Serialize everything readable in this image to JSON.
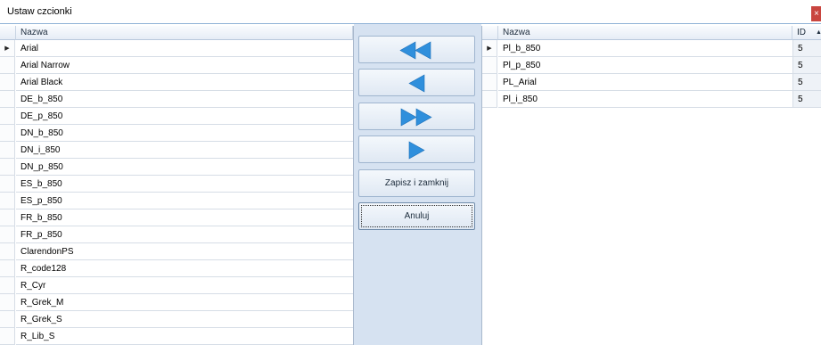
{
  "window": {
    "title": "Ustaw czcionki",
    "close_glyph": "×"
  },
  "left_grid": {
    "header": "Nazwa",
    "rows": [
      "Arial",
      "Arial Narrow",
      "Arial Black",
      "DE_b_850",
      "DE_p_850",
      "DN_b_850",
      "DN_i_850",
      "DN_p_850",
      "ES_b_850",
      "ES_p_850",
      "FR_b_850",
      "FR_p_850",
      "ClarendonPS",
      "R_code128",
      "R_Cyr",
      "R_Grek_M",
      "R_Grek_S",
      "R_Lib_S"
    ],
    "current_row": 0,
    "current_indicator": "▶"
  },
  "buttons": {
    "move_all_left_icon": "double-left-arrow-icon",
    "move_left_icon": "left-arrow-icon",
    "move_all_right_icon": "double-right-arrow-icon",
    "move_right_icon": "right-arrow-icon",
    "save_label": "Zapisz i zamknij",
    "cancel_label": "Anuluj",
    "arrow_color": "#2f8fdc"
  },
  "right_grid": {
    "headers": {
      "name": "Nazwa",
      "id": "ID"
    },
    "sort_indicator": "▲",
    "rows": [
      {
        "name": "Pl_b_850",
        "id": "5"
      },
      {
        "name": "Pl_p_850",
        "id": "5"
      },
      {
        "name": "PL_Arial",
        "id": "5"
      },
      {
        "name": "Pl_i_850",
        "id": "5"
      }
    ],
    "current_row": 0,
    "current_indicator": "▶"
  },
  "colors": {
    "title_border": "#8fb2d6",
    "close_bg": "#c9453f",
    "middle_panel": "#d6e2f1",
    "header_bg": "#e6edf6"
  }
}
